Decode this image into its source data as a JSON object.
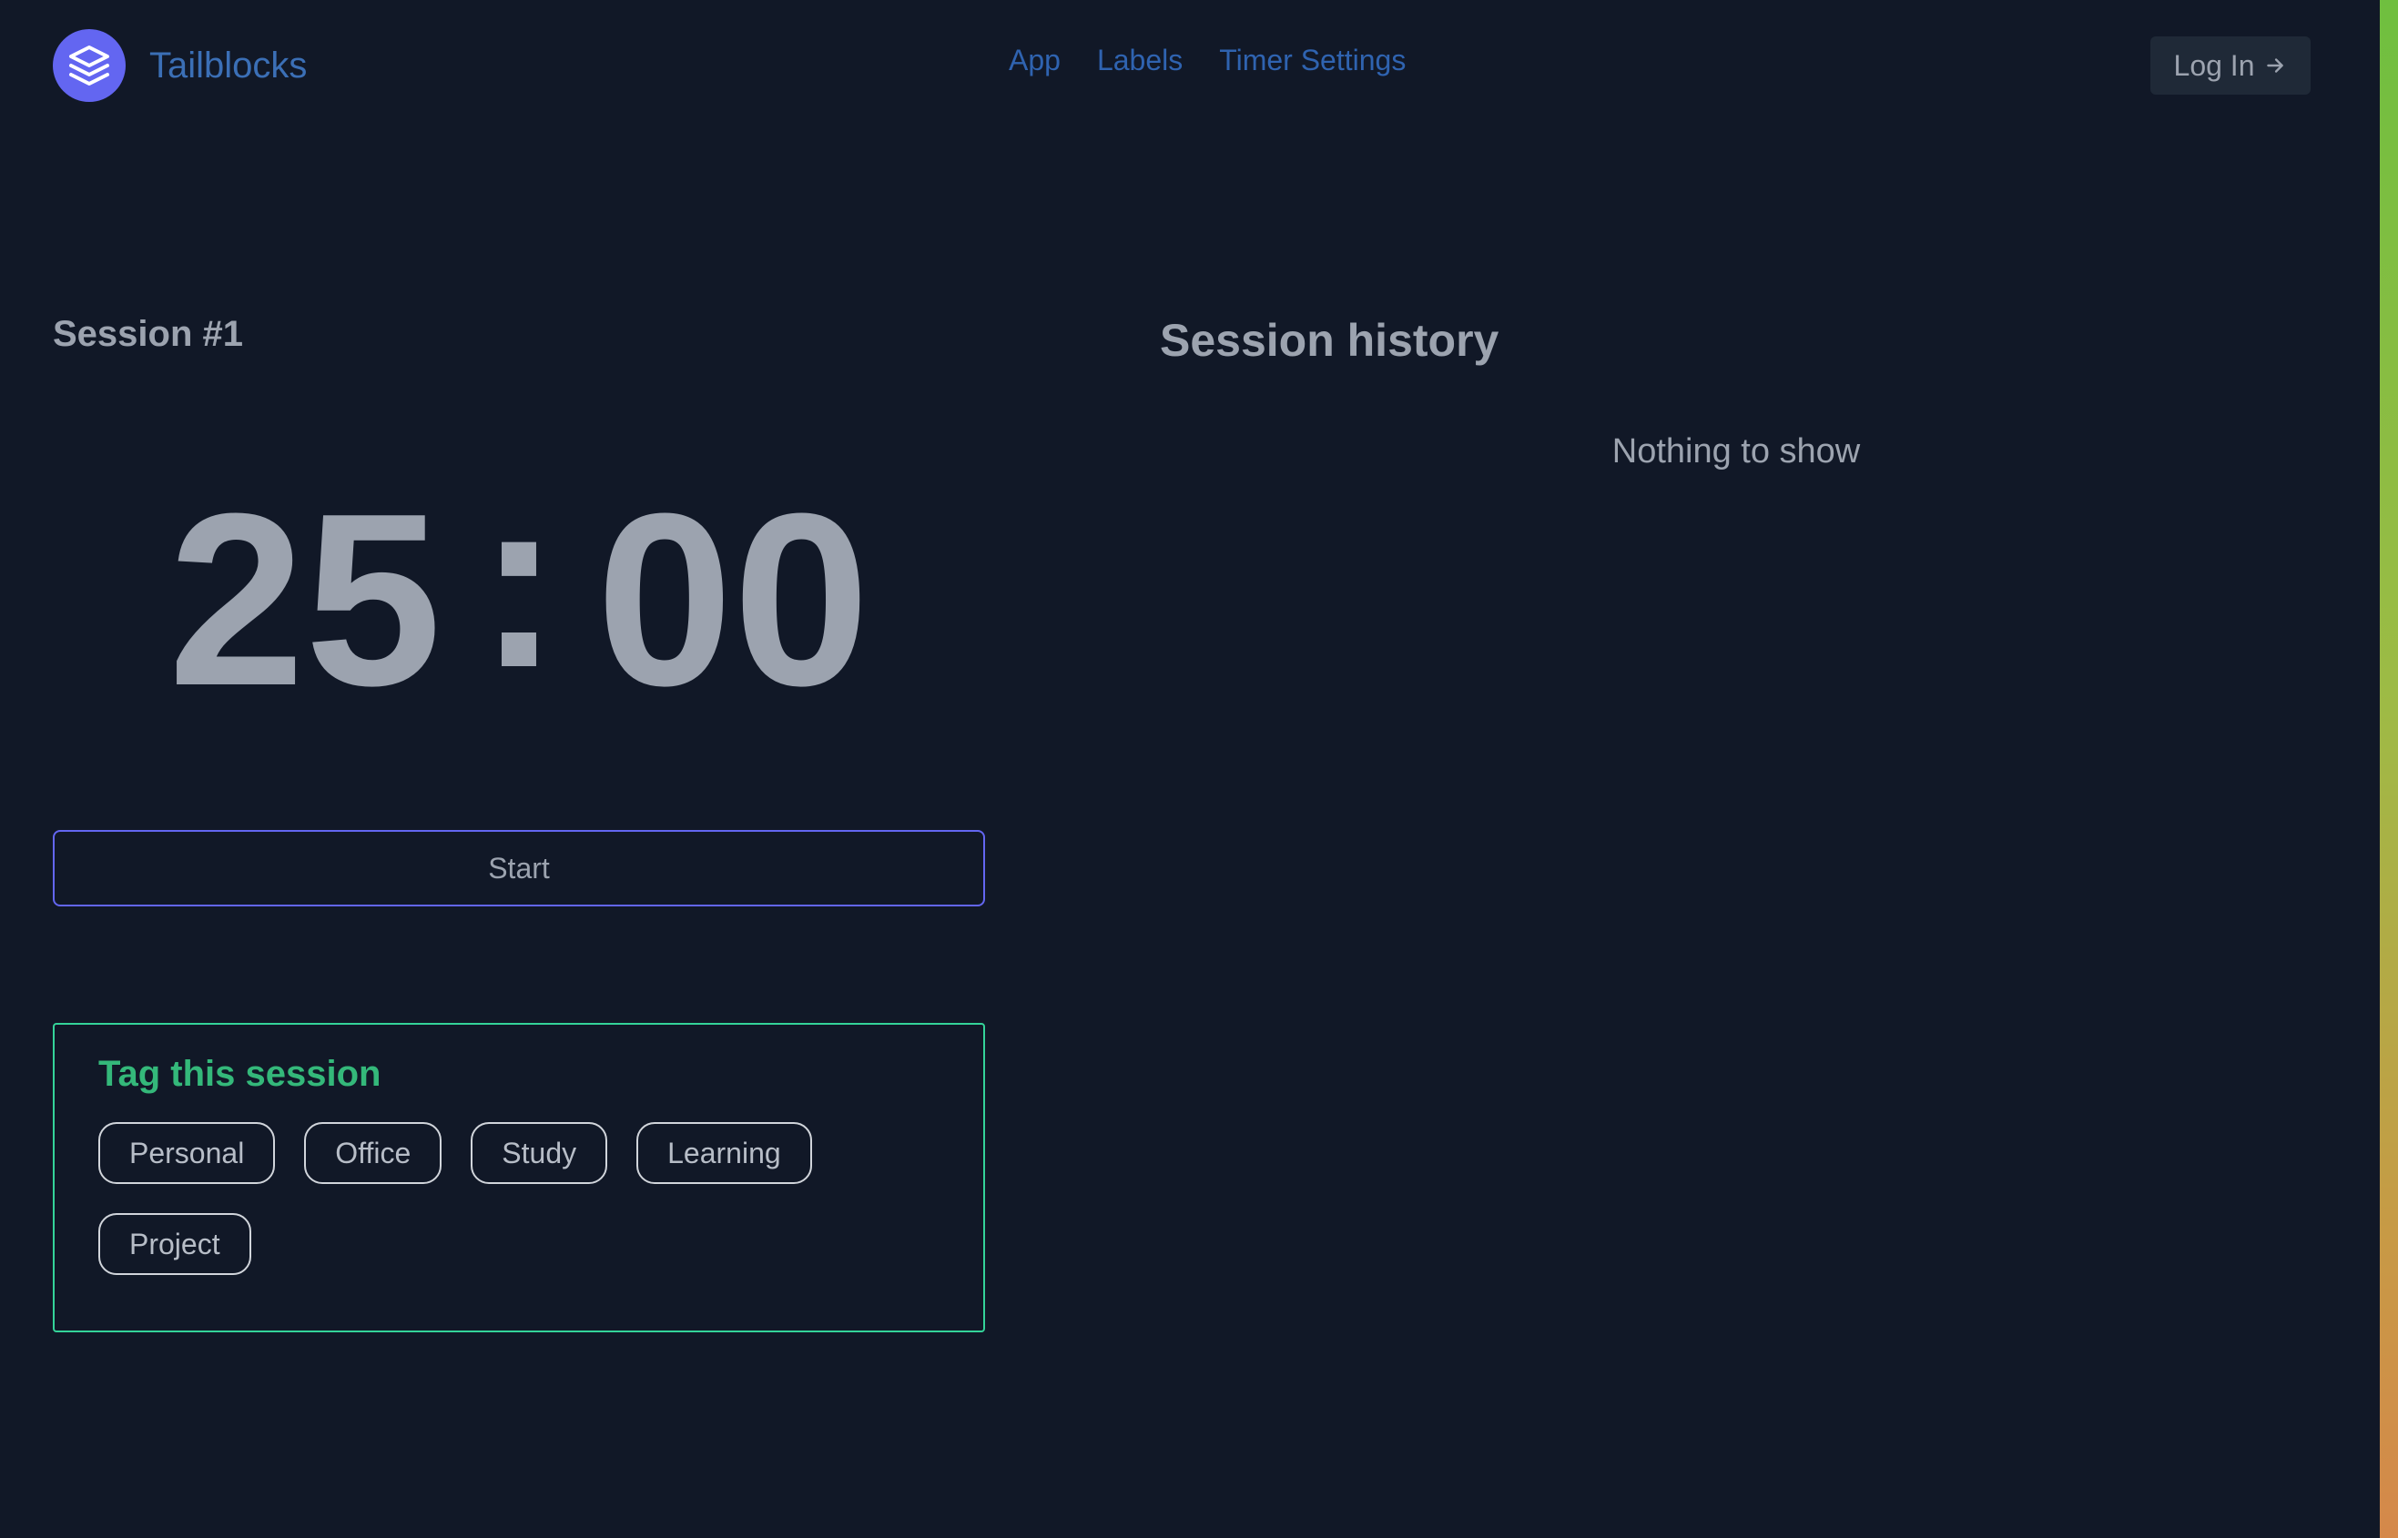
{
  "header": {
    "brand_name": "Tailblocks",
    "nav": [
      {
        "label": "App"
      },
      {
        "label": "Labels"
      },
      {
        "label": "Timer Settings"
      }
    ],
    "login_label": "Log In",
    "logo_icon": "stack-layers-icon",
    "login_icon": "arrow-right-icon"
  },
  "session": {
    "title": "Session #1",
    "timer": {
      "minutes": "25",
      "separator": ":",
      "seconds": "00"
    },
    "start_label": "Start"
  },
  "tagging": {
    "title": "Tag this session",
    "tags": [
      "Personal",
      "Office",
      "Study",
      "Learning",
      "Project"
    ]
  },
  "history": {
    "title": "Session history",
    "empty_text": "Nothing to show"
  },
  "colors": {
    "background": "#111827",
    "accent": "#6366f1",
    "nav_link": "#2f63b0",
    "tag_border": "#34d399",
    "tag_title": "#34b87a"
  }
}
